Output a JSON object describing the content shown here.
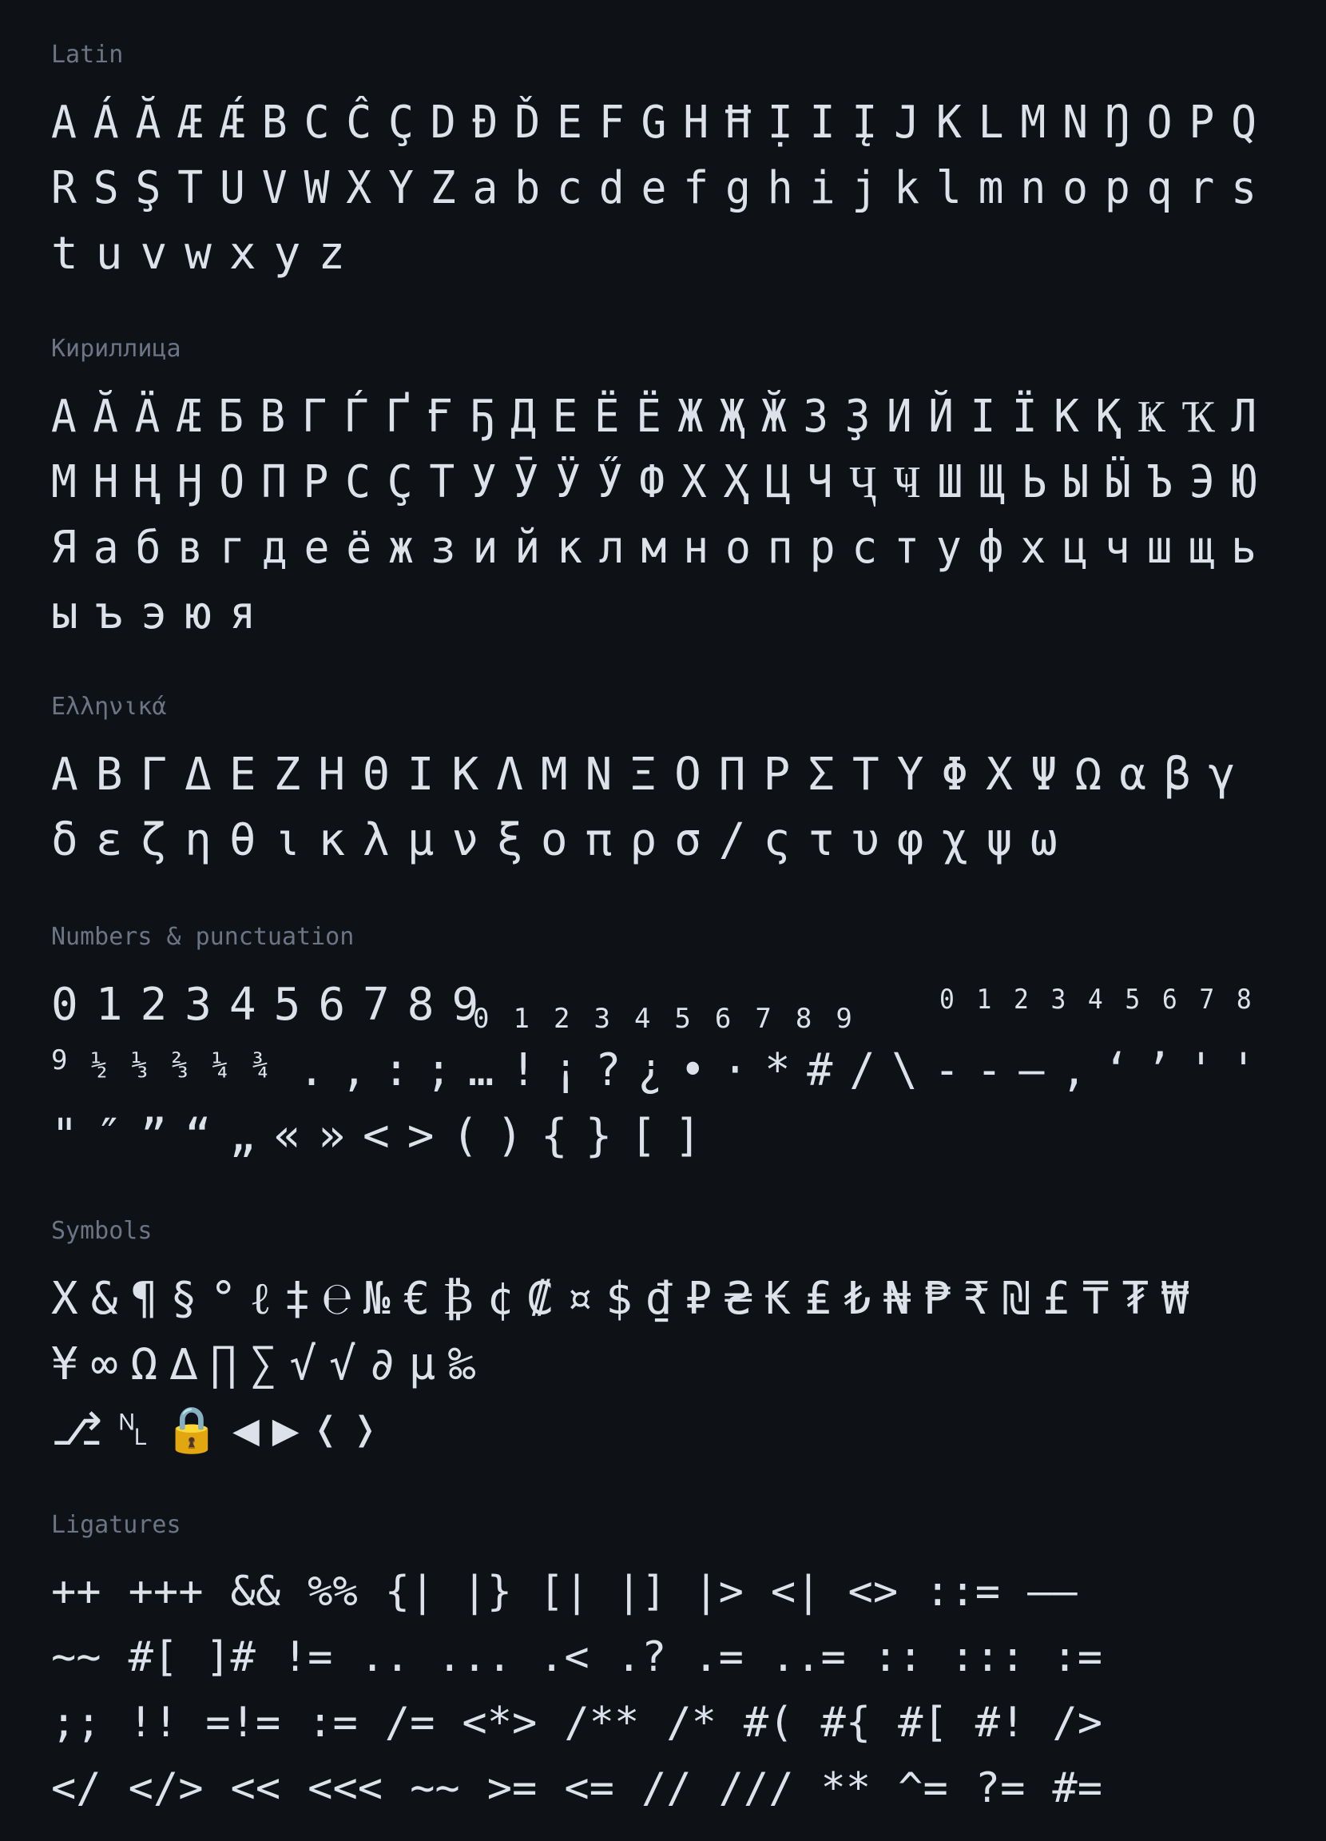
{
  "sections": {
    "latin": {
      "title": "Latin",
      "lines": [
        [
          "A",
          "Á",
          "Ă",
          "Æ",
          "Ǽ",
          "B",
          "C",
          "Ĉ",
          "Ç",
          "D",
          "Đ",
          "Ď",
          "E",
          "F",
          "G",
          "H",
          "Ħ",
          "Ị",
          "I",
          "Į",
          "J",
          "K",
          "L",
          "M",
          "N",
          "Ŋ",
          "O",
          "P",
          "Q"
        ],
        [
          "R",
          "S",
          "Ş",
          "T",
          "U",
          "V",
          "W",
          "X",
          "Y",
          "Z",
          "a",
          "b",
          "c",
          "d",
          "e",
          "f",
          "g",
          "h",
          "i",
          "j",
          "k",
          "l",
          "m",
          "n",
          "o",
          "p",
          "q",
          "r",
          "s"
        ],
        [
          "t",
          "u",
          "v",
          "w",
          "x",
          "y",
          "z"
        ]
      ]
    },
    "cyrillic": {
      "title": "Кириллица",
      "lines": [
        [
          "А",
          "Ӑ",
          "Ӓ",
          "Ӕ",
          "Б",
          "В",
          "Г",
          "Ѓ",
          "Ґ",
          "Ғ",
          "Ҕ",
          "Д",
          "Е",
          "Ё",
          "Ё",
          "Ж",
          "Җ",
          "Ӂ",
          "З",
          "Ҙ",
          "И",
          "Й",
          "І",
          "Ї",
          "К",
          "Қ",
          "Ҝ",
          "Ҡ",
          "Л"
        ],
        [
          "М",
          "Н",
          "Ң",
          "Ӈ",
          "О",
          "П",
          "Р",
          "С",
          "Ҫ",
          "Т",
          "У",
          "Ӯ",
          "Ӱ",
          "Ӳ",
          "Ф",
          "Х",
          "Ҳ",
          "Ц",
          "Ч",
          "Ҷ",
          "Ҹ",
          "Ш",
          "Щ",
          "Ь",
          "Ы",
          "Ӹ",
          "Ъ",
          "Э",
          "Ю"
        ],
        [
          "Я",
          "а",
          "б",
          "в",
          "г",
          "д",
          "е",
          "ё",
          "ж",
          "з",
          "и",
          "й",
          "к",
          "л",
          "м",
          "н",
          "о",
          "п",
          "р",
          "с",
          "т",
          "у",
          "ф",
          "х",
          "ц",
          "ч",
          "ш",
          "щ",
          "ь"
        ],
        [
          "ы",
          "ъ",
          "э",
          "ю",
          "я"
        ]
      ]
    },
    "greek": {
      "title": "Ελληνικά",
      "lines": [
        [
          "Α",
          "Β",
          "Γ",
          "Δ",
          "Ε",
          "Ζ",
          "Η",
          "Θ",
          "Ι",
          "Κ",
          "Λ",
          "Μ",
          "Ν",
          "Ξ",
          "Ο",
          "Π",
          "Ρ",
          "Σ",
          "Τ",
          "Υ",
          "Φ",
          "Χ",
          "Ψ",
          "Ω",
          "α",
          "β",
          "γ"
        ],
        [
          "δ",
          "ε",
          "ζ",
          "η",
          "θ",
          "ι",
          "κ",
          "λ",
          "μ",
          "ν",
          "ξ",
          "ο",
          "π",
          "ρ",
          "σ",
          "/",
          "ς",
          "τ",
          "υ",
          "φ",
          "χ",
          "ψ",
          "ω"
        ]
      ]
    },
    "numbers": {
      "title": "Numbers & punctuation",
      "lines": {
        "digits": [
          "0",
          "1",
          "2",
          "3",
          "4",
          "5",
          "6",
          "7",
          "8",
          "9"
        ],
        "subscripts": [
          "0",
          "1",
          "2",
          "3",
          "4",
          "5",
          "6",
          "7",
          "8",
          "9"
        ],
        "superscripts": [
          "0",
          "1",
          "2",
          "3",
          "4",
          "5",
          "6",
          "7",
          "8"
        ],
        "line2_superscript": [
          "9"
        ],
        "line2_fractions": [
          "½",
          "⅓",
          "⅔",
          "¼",
          "¾"
        ],
        "line2": [
          ".",
          ",",
          ":",
          ";",
          "…",
          "!",
          "¡",
          "?",
          "¿",
          "•",
          "·",
          "*",
          "#",
          "/",
          "\\",
          "-",
          "-",
          "–",
          ",",
          "‘",
          "’",
          "'",
          "'"
        ],
        "line3": [
          "\"",
          "″",
          "”",
          "“",
          "„",
          "«",
          "»",
          "<",
          ">",
          "(",
          ")",
          "{",
          "}",
          "[",
          "]"
        ]
      }
    },
    "symbols": {
      "title": "Symbols",
      "lines": [
        [
          "X",
          "&",
          "¶",
          "§",
          "°",
          "ℓ",
          "‡",
          "℮",
          "№",
          "€",
          "₿",
          "¢",
          "₡",
          "¤",
          "$",
          "₫",
          "₽",
          "₴",
          "₭",
          "₤",
          "₺",
          "₦",
          "₱",
          "₹",
          "₪",
          "£",
          "₸",
          "₮",
          "₩"
        ],
        [
          "¥",
          "∞",
          "Ω",
          "∆",
          "∏",
          "∑",
          "√",
          "√",
          "∂",
          "µ",
          "‰"
        ],
        [
          "⎇",
          "␤",
          "🔒",
          "◀",
          "▶",
          "❬",
          "❭"
        ]
      ]
    },
    "ligatures": {
      "title": "Ligatures",
      "lines": [
        [
          "++",
          "+++",
          "&&",
          "%%",
          "{|",
          "|}",
          "[|",
          "|]",
          "|>",
          "<|",
          "<>",
          "::=",
          "——"
        ],
        [
          "~~",
          "#[",
          "]#",
          "!=",
          "..",
          "...",
          ".<",
          ".?",
          ".=",
          "..=",
          "::",
          ":::",
          ":="
        ],
        [
          ";;",
          "!!",
          "=!=",
          ":=",
          "/=",
          "<*>",
          "/**",
          "/*",
          "#(",
          "#{",
          "#[",
          "#!",
          "/>"
        ],
        [
          "</",
          "</>",
          "<<",
          "<<<",
          "~~",
          ">=",
          "<=",
          "//",
          "///",
          "**",
          "^=",
          "?=",
          "#="
        ]
      ]
    }
  }
}
